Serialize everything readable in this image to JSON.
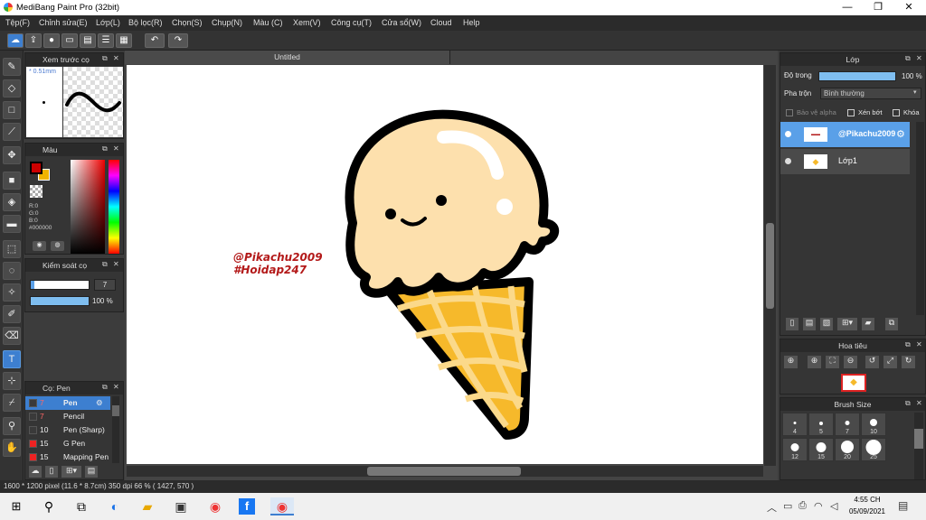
{
  "app": {
    "title": "MediBang Paint Pro (32bit)",
    "window_controls": {
      "minimize": "—",
      "restore": "❐",
      "close": "✕"
    }
  },
  "menu": [
    "Tệp(F)",
    "Chỉnh sửa(E)",
    "Lớp(L)",
    "Bộ lọc(R)",
    "Chọn(S)",
    "Chụp(N)",
    "Màu (C)",
    "Xem(V)",
    "Công cụ(T)",
    "Cửa sổ(W)",
    "Cloud",
    "Help"
  ],
  "toolbar": {
    "icons": [
      "cloud-icon",
      "upload-icon",
      "comment-icon",
      "message-icon",
      "page-icon",
      "list-icon",
      "grid-icon",
      "undo-icon",
      "redo-icon"
    ]
  },
  "brush_preview": {
    "title": "Xem trước cọ",
    "size_label": "* 0.51mm"
  },
  "color_panel": {
    "title": "Màu",
    "primary": "#cc0000",
    "secondary": "#f0b400",
    "r": "R:0",
    "g": "G:0",
    "b": "B:0",
    "hex": "#000000"
  },
  "brush_control": {
    "title": "Kiểm soát cọ",
    "size_value": "7",
    "opacity_value": "100 %"
  },
  "brush_list": {
    "title": "Cọ: Pen",
    "items": [
      {
        "size": "7",
        "name": "Pen",
        "color": "#3a3a3a"
      },
      {
        "size": "7",
        "name": "Pencil",
        "color": "#3a3a3a"
      },
      {
        "size": "10",
        "name": "Pen (Sharp)",
        "color": "#3a3a3a"
      },
      {
        "size": "15",
        "name": "G Pen",
        "color": "#ee2222"
      },
      {
        "size": "15",
        "name": "Mapping Pen",
        "color": "#ee2222"
      }
    ]
  },
  "document": {
    "tab_title": "Untitled",
    "watermark_line1": "@Pikachu2009",
    "watermark_line2": "#Hoidap247"
  },
  "layer_panel": {
    "title": "Lớp",
    "opacity_label": "Độ trong",
    "opacity_value": "100 %",
    "blend_label": "Pha trộn",
    "blend_value": "Bình thường",
    "protect_alpha": "Bảo vệ alpha",
    "clipping": "Xén bớt",
    "lock": "Khóa",
    "layers": [
      {
        "name": "@Pikachu2009",
        "selected": true
      },
      {
        "name": "Lớp1",
        "selected": false
      }
    ]
  },
  "navigator": {
    "title": "Hoa tiêu"
  },
  "brush_size": {
    "title": "Brush Size",
    "sizes": [
      "4",
      "5",
      "7",
      "10",
      "12",
      "15",
      "20",
      "25"
    ]
  },
  "status": {
    "text": "1600 * 1200 pixel   (11.6 * 8.7cm)   350 dpi   66 %   ( 1427, 570 )"
  },
  "taskbar": {
    "time": "4:55 CH",
    "date": "05/09/2021"
  },
  "colors": {
    "accent": "#3d7fd0",
    "icecream": "#fde0ad",
    "cone": "#f6b92b",
    "watermark": "#b31919"
  }
}
